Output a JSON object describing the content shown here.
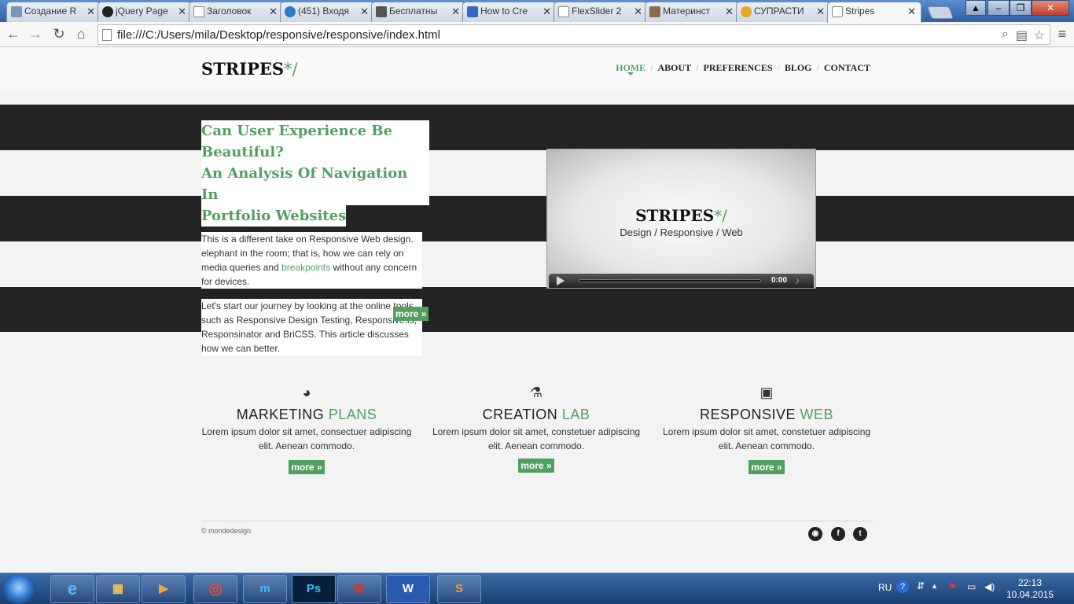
{
  "browser": {
    "tabs": [
      {
        "label": "Создание R",
        "icon": "habr-favicon"
      },
      {
        "label": "jQuery Page",
        "icon": "github-favicon"
      },
      {
        "label": "Заголовок",
        "icon": "page-favicon"
      },
      {
        "label": "(451) Входя",
        "icon": "mail-favicon"
      },
      {
        "label": "Бесплатны",
        "icon": "film-favicon"
      },
      {
        "label": "How to Cre",
        "icon": "site-favicon"
      },
      {
        "label": "FlexSlider 2",
        "icon": "page-favicon"
      },
      {
        "label": "Материнст",
        "icon": "people-favicon"
      },
      {
        "label": "СУПРАСТИ",
        "icon": "pharmacy-favicon"
      },
      {
        "label": "Stripes",
        "icon": "page-favicon"
      }
    ],
    "active_tab": 9,
    "url": "file:///C:/Users/mila/Desktop/responsive/responsive/index.html"
  },
  "site": {
    "logo_text": "STRIPES",
    "logo_accent": "*/",
    "nav": [
      "HOME",
      "ABOUT",
      "PREFERENCES",
      "BLOG",
      "CONTACT"
    ],
    "nav_sep": "/",
    "active_nav": "HOME",
    "accent_color": "#52a060",
    "hero": {
      "headline": [
        "Can User Experience Be Beautiful?",
        "An Analysis Of Navigation In",
        "Portfolio Websites"
      ],
      "p1_before": "This is a different take on Responsive Web design. elephant in the room; that is, how we can rely on media queries and ",
      "p1_link": "breakpoints",
      "p1_after": " without any concern for devices.",
      "p2": "Let's start our journey by looking at the online tools such as Responsive Design Testing, Responsive.is, Responsinator and BriCSS. This article discusses how we can better.",
      "more": "more »"
    },
    "video": {
      "logo_text": "STRIPES",
      "logo_accent": "*/",
      "subtitle": "Design / Responsive / Web",
      "time": "0:00"
    },
    "features": [
      {
        "icon": "pie-chart-icon",
        "title_dark": "MARKETING",
        "title_green": "PLANS",
        "text": "Lorem ipsum dolor sit amet, consectuer adipiscing elit. Aenean commodo.",
        "more": "more »"
      },
      {
        "icon": "microscope-icon",
        "title_dark": "CREATION",
        "title_green": "LAB",
        "text": "Lorem ipsum dolor sit amet, constetuer adipiscing elit. Aenean commodo.",
        "more": "more »"
      },
      {
        "icon": "terminal-icon",
        "title_dark": "RESPONSIVE",
        "title_green": "WEB",
        "text": "Lorem ipsum dolor sit amet, constetuer adipiscing elit. Aenean commodo.",
        "more": "more »"
      }
    ],
    "footer": {
      "copyright": "© mondedesign",
      "social": [
        "rss-icon",
        "facebook-icon",
        "twitter-icon"
      ]
    }
  },
  "taskbar": {
    "apps": [
      "internet-explorer",
      "file-explorer",
      "media-player",
      "chrome",
      "maxthon",
      "photoshop",
      "winrar",
      "word",
      "sublime-text"
    ],
    "ps_label": "Ps",
    "word_label": "W",
    "lang": "RU",
    "time": "22:13",
    "date": "10.04.2015"
  }
}
